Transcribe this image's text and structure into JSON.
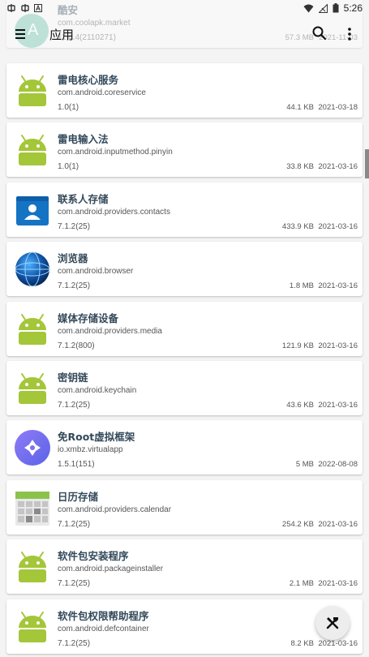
{
  "status_bar": {
    "time": "5:26"
  },
  "app_bar": {
    "title": "应用",
    "logo_text": "A"
  },
  "apps": [
    {
      "name": "酷安",
      "package": "com.coolapk.market",
      "version": "11.4.4(2110271)",
      "size": "57.3 MB",
      "date": "2021-11-03",
      "icon": "coolapk-icon"
    },
    {
      "name": "雷电核心服务",
      "package": "com.android.coreservice",
      "version": "1.0(1)",
      "size": "44.1 KB",
      "date": "2021-03-18",
      "icon": "android-icon"
    },
    {
      "name": "雷电输入法",
      "package": "com.android.inputmethod.pinyin",
      "version": "1.0(1)",
      "size": "33.8 KB",
      "date": "2021-03-16",
      "icon": "android-icon"
    },
    {
      "name": "联系人存储",
      "package": "com.android.providers.contacts",
      "version": "7.1.2(25)",
      "size": "433.9 KB",
      "date": "2021-03-16",
      "icon": "contacts-icon"
    },
    {
      "name": "浏览器",
      "package": "com.android.browser",
      "version": "7.1.2(25)",
      "size": "1.8 MB",
      "date": "2021-03-16",
      "icon": "globe-icon"
    },
    {
      "name": "媒体存储设备",
      "package": "com.android.providers.media",
      "version": "7.1.2(800)",
      "size": "121.9 KB",
      "date": "2021-03-16",
      "icon": "android-icon"
    },
    {
      "name": "密钥链",
      "package": "com.android.keychain",
      "version": "7.1.2(25)",
      "size": "43.6 KB",
      "date": "2021-03-16",
      "icon": "android-icon"
    },
    {
      "name": "免Root虚拟框架",
      "package": "io.xmbz.virtualapp",
      "version": "1.5.1(151)",
      "size": "5 MB",
      "date": "2022-08-08",
      "icon": "virtualapp-icon"
    },
    {
      "name": "日历存储",
      "package": "com.android.providers.calendar",
      "version": "7.1.2(25)",
      "size": "254.2 KB",
      "date": "2021-03-16",
      "icon": "calendar-icon"
    },
    {
      "name": "软件包安装程序",
      "package": "com.android.packageinstaller",
      "version": "7.1.2(25)",
      "size": "2.1 MB",
      "date": "2021-03-16",
      "icon": "android-icon"
    },
    {
      "name": "软件包权限帮助程序",
      "package": "com.android.defcontainer",
      "version": "7.1.2(25)",
      "size": "8.2 KB",
      "date": "2021-03-16",
      "icon": "android-icon"
    }
  ],
  "colors": {
    "android_green": "#a4c639",
    "title_text": "#33495a",
    "card_bg": "#ffffff",
    "page_bg": "#f4f4f4"
  }
}
